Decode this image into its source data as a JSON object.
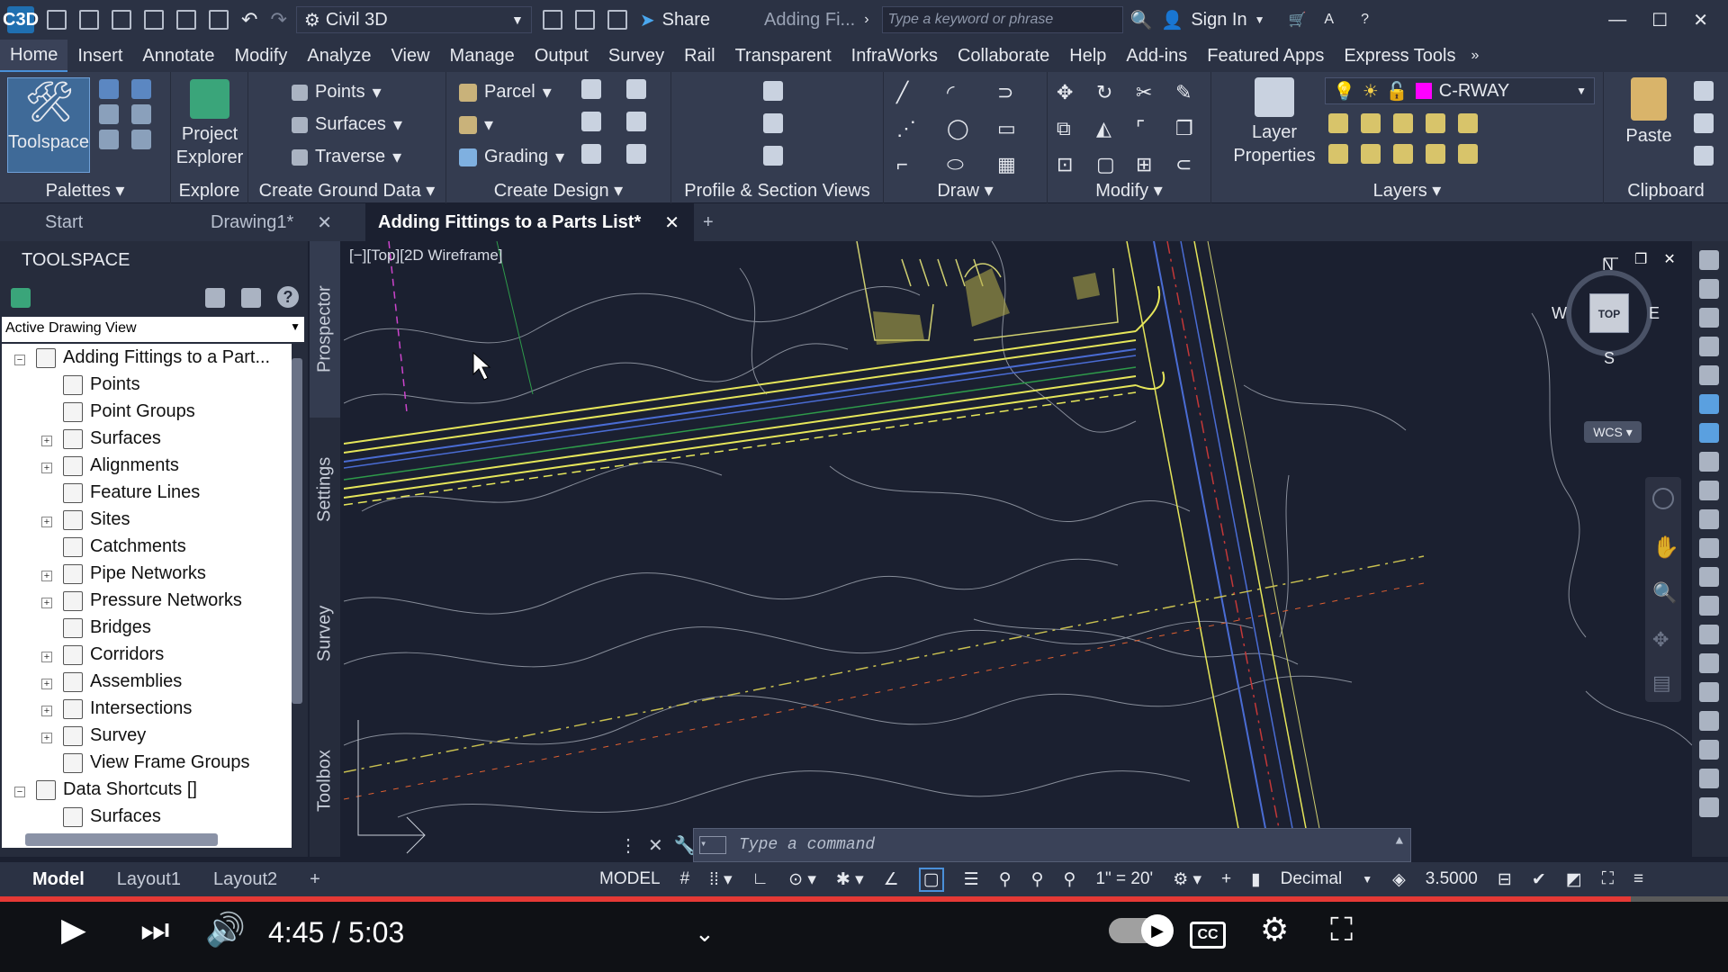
{
  "titlebar": {
    "app_logo": "C3D",
    "workspace": "Civil 3D",
    "share": "Share",
    "doc_title": "Adding Fi...",
    "search_placeholder": "Type a keyword or phrase",
    "sign_in": "Sign In"
  },
  "menus": [
    "Home",
    "Insert",
    "Annotate",
    "Modify",
    "Analyze",
    "View",
    "Manage",
    "Output",
    "Survey",
    "Rail",
    "Transparent",
    "InfraWorks",
    "Collaborate",
    "Help",
    "Add-ins",
    "Featured Apps",
    "Express Tools"
  ],
  "ribbon": {
    "toolspace": "Toolspace",
    "project_explorer": "Project Explorer",
    "points": "Points",
    "surfaces": "Surfaces",
    "traverse": "Traverse",
    "parcel": "Parcel",
    "grading": "Grading",
    "layer_properties": "Layer Properties",
    "layer_name": "C-RWAY",
    "paste": "Paste",
    "panels": {
      "palettes": "Palettes",
      "explore": "Explore",
      "create_ground_data": "Create Ground Data",
      "create_design": "Create Design",
      "profile_section": "Profile & Section Views",
      "draw": "Draw",
      "modify": "Modify",
      "layers": "Layers",
      "clipboard": "Clipboard"
    }
  },
  "file_tabs": [
    {
      "label": "Start"
    },
    {
      "label": "Drawing1*"
    },
    {
      "label": "Adding Fittings to a Parts List*"
    }
  ],
  "toolspace": {
    "title": "TOOLSPACE",
    "view": "Active Drawing View",
    "root": "Adding Fittings to a Part...",
    "items": [
      "Points",
      "Point Groups",
      "Surfaces",
      "Alignments",
      "Feature Lines",
      "Sites",
      "Catchments",
      "Pipe Networks",
      "Pressure Networks",
      "Bridges",
      "Corridors",
      "Assemblies",
      "Intersections",
      "Survey",
      "View Frame Groups"
    ],
    "data_shortcuts": "Data Shortcuts []",
    "ds_surfaces": "Surfaces",
    "vtabs": [
      "Prospector",
      "Settings",
      "Survey",
      "Toolbox"
    ]
  },
  "viewport": {
    "label": "[−][Top][2D Wireframe]",
    "compass": {
      "n": "N",
      "s": "S",
      "e": "E",
      "w": "W",
      "top": "TOP",
      "wcs": "WCS"
    }
  },
  "command": {
    "placeholder": "Type a command"
  },
  "status": {
    "tabs": [
      "Model",
      "Layout1",
      "Layout2"
    ],
    "model": "MODEL",
    "scale": "1\" = 20'",
    "units": "Decimal",
    "elevation": "3.5000"
  },
  "video": {
    "time": "4:45 / 5:03",
    "progress": 0.944
  },
  "colors": {
    "accent": "#4a90d9",
    "layer_swatch": "#ff00ff",
    "progress": "#e53935"
  }
}
